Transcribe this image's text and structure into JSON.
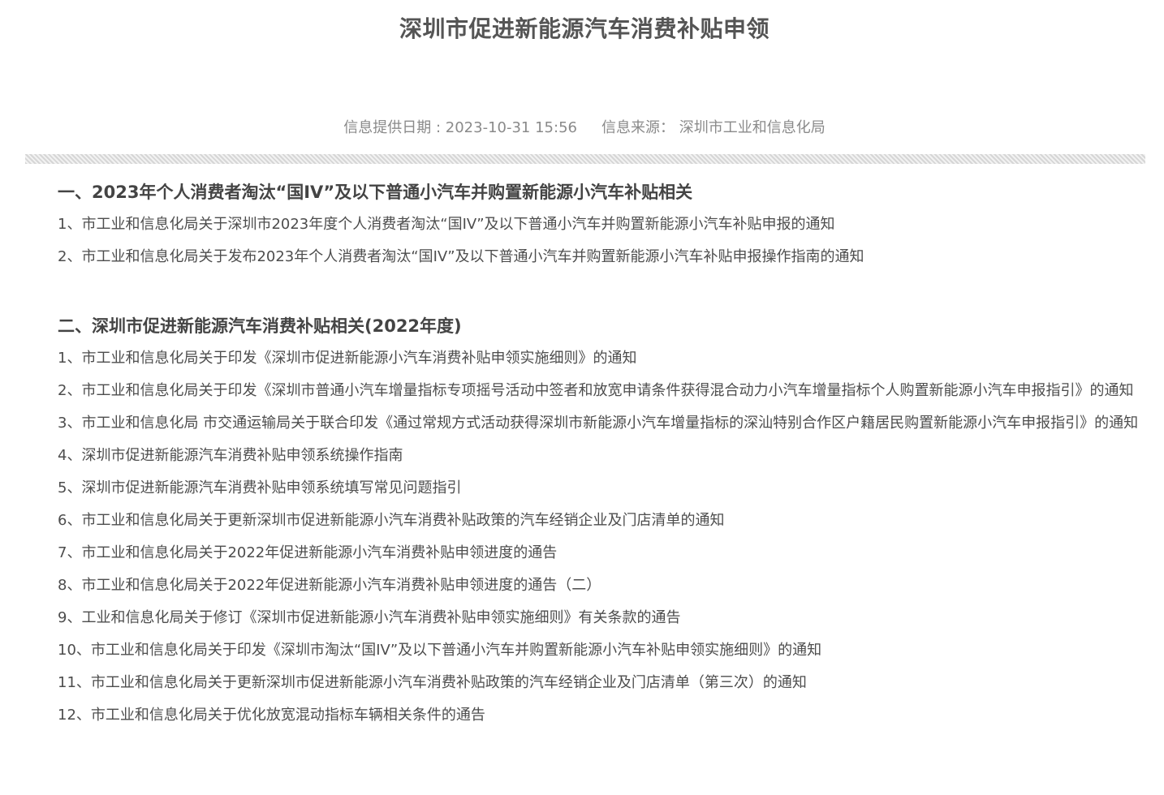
{
  "page": {
    "title": "深圳市促进新能源汽车消费补贴申领",
    "meta": {
      "date_label": "信息提供日期 : 2023-10-31 15:56",
      "source_label": "信息来源：  深圳市工业和信息化局"
    }
  },
  "sections": [
    {
      "heading": "一、2023年个人消费者淘汰“国IV”及以下普通小汽车并购置新能源小汽车补贴相关",
      "items": [
        "1、市工业和信息化局关于深圳市2023年度个人消费者淘汰“国IV”及以下普通小汽车并购置新能源小汽车补贴申报的通知",
        "2、市工业和信息化局关于发布2023年个人消费者淘汰“国IV”及以下普通小汽车并购置新能源小汽车补贴申报操作指南的通知"
      ]
    },
    {
      "heading": "二、深圳市促进新能源汽车消费补贴相关(2022年度)",
      "items": [
        "1、市工业和信息化局关于印发《深圳市促进新能源小汽车消费补贴申领实施细则》的通知",
        "2、市工业和信息化局关于印发《深圳市普通小汽车增量指标专项摇号活动中签者和放宽申请条件获得混合动力小汽车增量指标个人购置新能源小汽车申报指引》的通知",
        "3、市工业和信息化局 市交通运输局关于联合印发《通过常规方式活动获得深圳市新能源小汽车增量指标的深汕特别合作区户籍居民购置新能源小汽车申报指引》的通知",
        "4、深圳市促进新能源汽车消费补贴申领系统操作指南",
        "5、深圳市促进新能源汽车消费补贴申领系统填写常见问题指引",
        "6、市工业和信息化局关于更新深圳市促进新能源小汽车消费补贴政策的汽车经销企业及门店清单的通知",
        "7、市工业和信息化局关于2022年促进新能源小汽车消费补贴申领进度的通告",
        "8、市工业和信息化局关于2022年促进新能源小汽车消费补贴申领进度的通告（二）",
        "9、工业和信息化局关于修订《深圳市促进新能源小汽车消费补贴申领实施细则》有关条款的通告",
        "10、市工业和信息化局关于印发《深圳市淘汰“国IV”及以下普通小汽车并购置新能源小汽车补贴申领实施细则》的通知",
        "11、市工业和信息化局关于更新深圳市促进新能源小汽车消费补贴政策的汽车经销企业及门店清单（第三次）的通知",
        "12、市工业和信息化局关于优化放宽混动指标车辆相关条件的通告"
      ]
    }
  ]
}
